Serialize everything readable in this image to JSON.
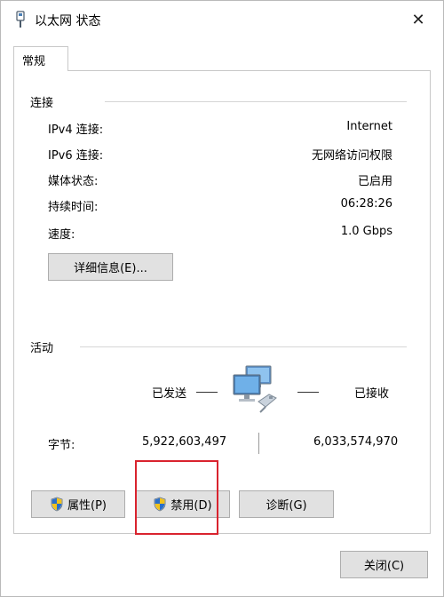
{
  "window": {
    "title": "以太网 状态",
    "close_label": "✕"
  },
  "tabs": [
    {
      "label": "常规"
    }
  ],
  "connection": {
    "group_title": "连接",
    "rows": [
      {
        "label": "IPv4 连接:",
        "value": "Internet"
      },
      {
        "label": "IPv6 连接:",
        "value": "无网络访问权限"
      },
      {
        "label": "媒体状态:",
        "value": "已启用"
      },
      {
        "label": "持续时间:",
        "value": "06:28:26"
      },
      {
        "label": "速度:",
        "value": "1.0 Gbps"
      }
    ],
    "details_button": "详细信息(E)..."
  },
  "activity": {
    "group_title": "活动",
    "sent_label": "已发送",
    "received_label": "已接收",
    "bytes_label": "字节:",
    "bytes_sent": "5,922,603,497",
    "bytes_received": "6,033,574,970"
  },
  "buttons": {
    "properties": "属性(P)",
    "disable": "禁用(D)",
    "diagnose": "诊断(G)",
    "close": "关闭(C)"
  },
  "icons": {
    "title": "network-adapter-icon",
    "activity": "network-computers-icon",
    "uac": "uac-shield-icon"
  },
  "colors": {
    "highlight": "#d9232e",
    "button_bg": "#e1e1e1"
  }
}
